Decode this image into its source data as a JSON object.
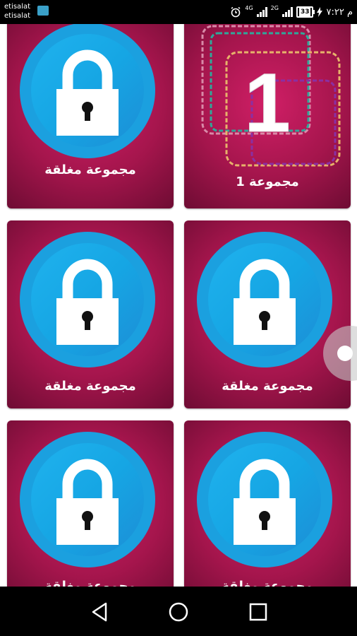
{
  "status_bar": {
    "carrier_1": "etisalat",
    "carrier_2": "etisalat",
    "network_1": "4G",
    "network_2": "2G",
    "battery": "33",
    "time": "م ٧:٢٢"
  },
  "groups": [
    {
      "label": "مجموعة مغلقة",
      "locked": true
    },
    {
      "label": "مجموعة 1",
      "locked": false,
      "number": "1"
    },
    {
      "label": "مجموعة مغلقة",
      "locked": true
    },
    {
      "label": "مجموعة مغلقة",
      "locked": true
    },
    {
      "label": "مجموعة مغلقة",
      "locked": true
    },
    {
      "label": "مجموعة مغلقة",
      "locked": true
    }
  ],
  "nav": {
    "back_icon": "back-triangle-icon",
    "home_icon": "home-circle-icon",
    "recents_icon": "recents-square-icon"
  },
  "colors": {
    "card": "#a4154c",
    "lock_circle": "#1ba0df",
    "lock_body": "#ffffff"
  }
}
